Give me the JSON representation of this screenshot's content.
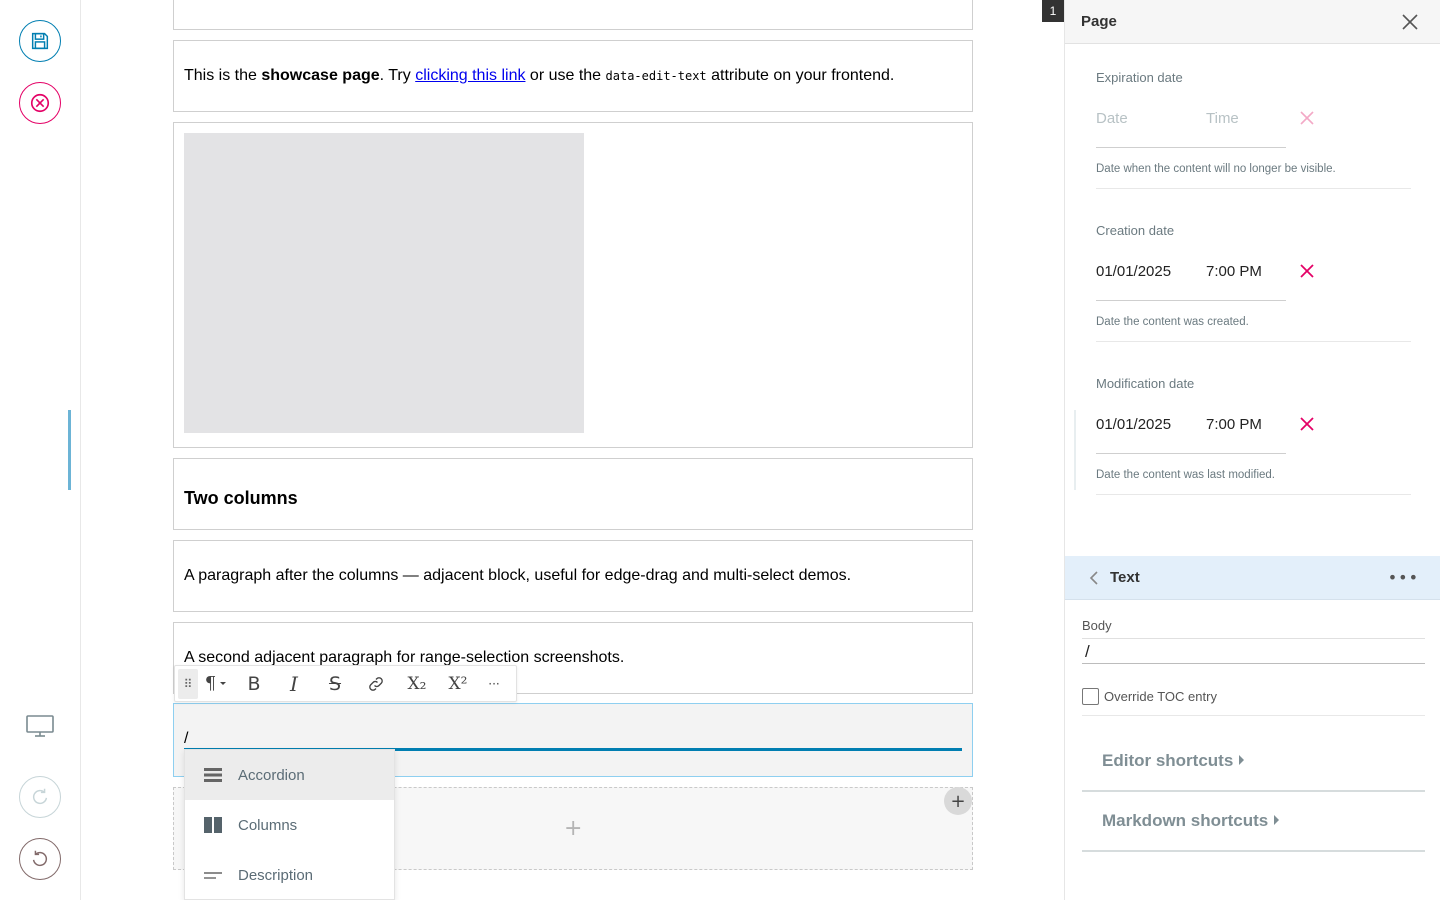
{
  "toolbar": {
    "save_icon": "floppy-disk-icon",
    "cancel_icon": "close-circle-icon",
    "display_icon": "monitor-icon",
    "redo_icon": "redo-icon",
    "undo_icon": "undo-icon",
    "colors": {
      "save": "#007eb1",
      "cancel": "#e40166"
    }
  },
  "content": {
    "showcase": {
      "text_1": "This is the ",
      "bold": "showcase page",
      "text_2": ". Try ",
      "link": "clicking this link",
      "text_3": " or use the ",
      "code": "data-edit-text",
      "text_4": " attribute on your frontend."
    },
    "heading": "Two columns",
    "paragraph_1": "A paragraph after the columns — adjacent block, useful for edge-drag and multi-select demos.",
    "paragraph_2": "A second adjacent paragraph for range-selection screenshots.",
    "active_block_text": "/",
    "add_block_symbol": "+",
    "add_corner_symbol": "+"
  },
  "format_toolbar": {
    "handle": "⠿",
    "buttons": [
      {
        "name": "paragraph-style",
        "glyph": "¶",
        "icon": "pilcrow-icon"
      },
      {
        "name": "bold",
        "glyph": "B",
        "icon": "bold-icon"
      },
      {
        "name": "italic",
        "glyph": "I",
        "icon": "italic-icon"
      },
      {
        "name": "strikethrough",
        "glyph": "S",
        "icon": "strikethrough-icon"
      },
      {
        "name": "link",
        "glyph": "🔗",
        "icon": "link-icon"
      },
      {
        "name": "subscript",
        "glyph": "X₂",
        "icon": "subscript-icon"
      },
      {
        "name": "superscript",
        "glyph": "X²",
        "icon": "superscript-icon"
      },
      {
        "name": "more",
        "glyph": "···",
        "icon": "more-icon"
      }
    ]
  },
  "slash_menu": {
    "items": [
      {
        "label": "Accordion",
        "icon": "accordion-icon"
      },
      {
        "label": "Columns",
        "icon": "columns-icon"
      },
      {
        "label": "Description",
        "icon": "description-icon"
      }
    ]
  },
  "sidebar": {
    "badge": "1",
    "title": "Page",
    "close_icon": "close-icon",
    "expiration": {
      "label": "Expiration date",
      "date_placeholder": "Date",
      "time_placeholder": "Time",
      "help": "Date when the content will no longer be visible."
    },
    "creation": {
      "label": "Creation date",
      "date": "01/01/2025",
      "time": "7:00 PM",
      "help": "Date the content was created."
    },
    "modification": {
      "label": "Modification date",
      "date": "01/01/2025",
      "time": "7:00 PM",
      "help": "Date the content was last modified."
    },
    "text_block": {
      "title": "Text",
      "more": "•••",
      "body_label": "Body",
      "body_value": "/",
      "toc_label": "Override TOC entry",
      "editor_shortcuts": "Editor shortcuts",
      "markdown_shortcuts": "Markdown shortcuts"
    },
    "colors": {
      "clear_inactive": "#f3a9c6",
      "clear_active": "#e40166",
      "text_header_bg": "#e3effa"
    }
  }
}
